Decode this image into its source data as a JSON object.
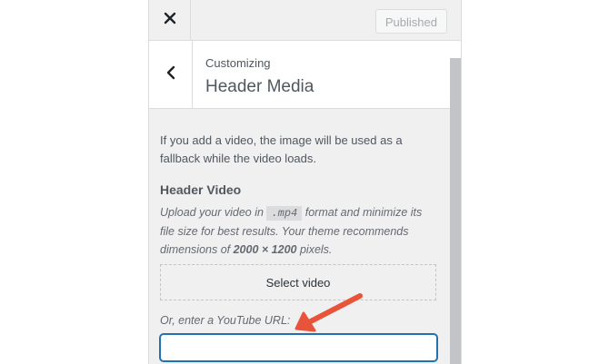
{
  "topbar": {
    "close_icon": "close-icon",
    "publish_label": "Published"
  },
  "section": {
    "back_icon": "chevron-left-icon",
    "breadcrumb": "Customizing",
    "title": "Header Media"
  },
  "content": {
    "description": "If you add a video, the image will be used as a fallback while the video loads.",
    "video_heading": "Header Video",
    "help": {
      "part1": "Upload your video in",
      "format": ".mp4",
      "part2": "format and minimize its file size for best results. Your theme recommends dimensions of",
      "dimensions": "2000 × 1200",
      "part3": "pixels."
    },
    "select_video_label": "Select video",
    "youtube_label": "Or, enter a YouTube URL:",
    "youtube_value": ""
  },
  "annotation": {
    "arrow_color": "#e8543a"
  },
  "colors": {
    "accent": "#2271b1",
    "panel_bg": "#f0f0f1"
  }
}
